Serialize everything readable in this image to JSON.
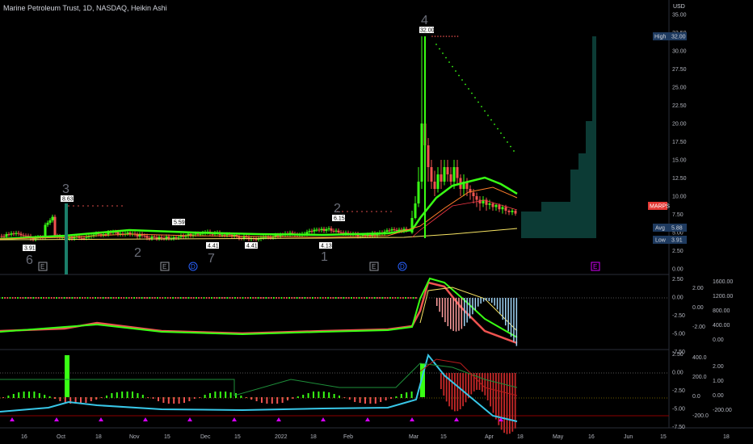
{
  "header": {
    "title": "Marine Petroleum Trust, 1D, NASDAQ, Heikin Ashi",
    "currency": "USD"
  },
  "price_axis": {
    "ticks": [
      "35.00",
      "32.50",
      "30.00",
      "27.50",
      "25.00",
      "22.50",
      "20.00",
      "17.50",
      "15.00",
      "12.50",
      "10.00",
      "7.50",
      "5.00",
      "2.50",
      "0.00"
    ],
    "high_label": "High",
    "high_value": "32.00",
    "avg_label": "Avg",
    "avg_value": "5.88",
    "low_label": "Low",
    "low_value": "3.91",
    "symbol_tag": "MARPS"
  },
  "price_labels": [
    "8.63",
    "3.91",
    "5.59",
    "4.41",
    "4.41",
    "6.15",
    "4.13",
    "32.00"
  ],
  "wave_labels": [
    "3",
    "6",
    "2",
    "7",
    "2",
    "1",
    "4"
  ],
  "event_markers": [
    "E",
    "E",
    "D",
    "E",
    "D",
    "E"
  ],
  "osc1_axis": {
    "ticks": [
      "2.50",
      "0.00",
      "-2.50",
      "-5.00",
      "-7.50"
    ],
    "right_ticks": [
      "2.00",
      "0.00",
      "-2.00"
    ],
    "far_ticks": [
      "1600.00",
      "1200.00",
      "800.00",
      "400.00",
      "0.00"
    ]
  },
  "osc2_axis": {
    "ticks": [
      "2.50",
      "0.00",
      "-2.50",
      "-5.00",
      "-7.50"
    ],
    "right_ticks": [
      "400.0",
      "200.0",
      "0.0",
      "-200.0"
    ],
    "far_ticks": [
      "2.00",
      "1.00",
      "0.00",
      "-200.00"
    ]
  },
  "time_axis": [
    "16",
    "Oct",
    "18",
    "Nov",
    "15",
    "Dec",
    "15",
    "2022",
    "18",
    "Feb",
    "Mar",
    "15",
    "Apr",
    "18",
    "May",
    "16",
    "Jun",
    "15",
    "18"
  ],
  "colors": {
    "bull": "#26a69a",
    "bear": "#ef5350",
    "lime": "#39ff14",
    "orange": "#ff7f2a",
    "yellow": "#f7e463",
    "cyan": "#38c7e8",
    "magenta": "#d500f9",
    "volume": "#0c3b35"
  }
}
